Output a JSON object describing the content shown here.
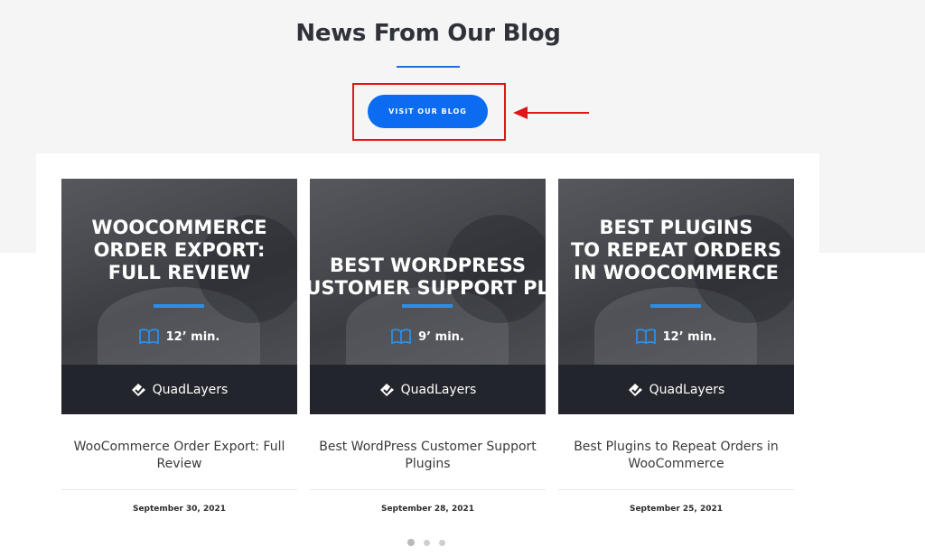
{
  "section": {
    "heading": "News From Our Blog",
    "button_label": "VISIT OUR BLOG",
    "accent_color": "#0b6cf2",
    "highlight_color": "#e0161a"
  },
  "posts": [
    {
      "image_title_lines": "WOOCOMMERCE\nORDER EXPORT:\nFULL REVIEW",
      "read_time": "12’ min.",
      "brand": "QuadLayers",
      "title": "WooCommerce Order Export: Full Review",
      "date": "September 30, 2021"
    },
    {
      "image_title_lines": "BEST WORDPRESS\nCUSTOMER SUPPORT PLUGINS",
      "read_time": "9’ min.",
      "brand": "QuadLayers",
      "title": "Best WordPress Customer Support Plugins",
      "date": "September 28, 2021"
    },
    {
      "image_title_lines": "BEST PLUGINS\nTO REPEAT ORDERS\nIN WOOCOMMERCE",
      "read_time": "12’ min.",
      "brand": "QuadLayers",
      "title": "Best Plugins to Repeat Orders in WooCommerce",
      "date": "September 25, 2021"
    }
  ],
  "carousel": {
    "page_count": 3,
    "active_index": 0
  }
}
